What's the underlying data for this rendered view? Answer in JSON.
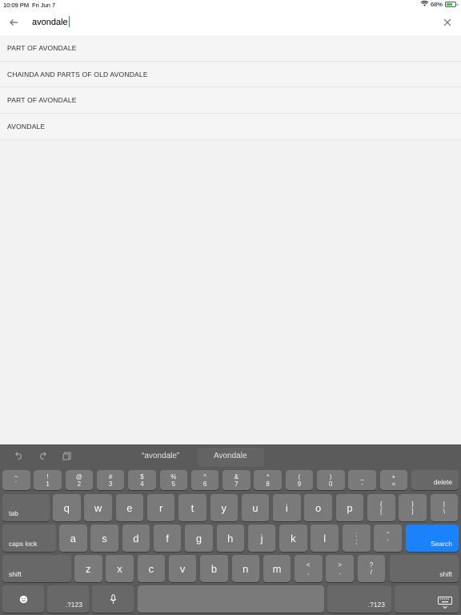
{
  "status_bar": {
    "time": "10:09 PM",
    "date": "Fri Jun 7",
    "battery_percent": "68%",
    "battery_level": 0.68,
    "wifi_icon": "wifi-icon"
  },
  "search": {
    "query": "avondale",
    "back_icon": "arrow-left-icon",
    "clear_icon": "close-icon"
  },
  "results": [
    {
      "label": "PART OF AVONDALE"
    },
    {
      "label": "CHAINDA AND PARTS OF OLD AVONDALE"
    },
    {
      "label": "PART OF AVONDALE"
    },
    {
      "label": "AVONDALE"
    }
  ],
  "keyboard": {
    "suggestions": [
      "“avondale”",
      "Avondale"
    ],
    "toolbar_icons": [
      "undo-icon",
      "redo-icon",
      "paste-icon"
    ],
    "number_row": [
      {
        "top": "~",
        "bot": "`"
      },
      {
        "top": "!",
        "bot": "1"
      },
      {
        "top": "@",
        "bot": "2"
      },
      {
        "top": "#",
        "bot": "3"
      },
      {
        "top": "$",
        "bot": "4"
      },
      {
        "top": "%",
        "bot": "5"
      },
      {
        "top": "^",
        "bot": "6"
      },
      {
        "top": "&",
        "bot": "7"
      },
      {
        "top": "*",
        "bot": "8"
      },
      {
        "top": "(",
        "bot": "9"
      },
      {
        "top": ")",
        "bot": "0"
      },
      {
        "top": "_",
        "bot": "-"
      },
      {
        "top": "+",
        "bot": "="
      }
    ],
    "delete_label": "delete",
    "tab_label": "tab",
    "row_q": [
      "q",
      "w",
      "e",
      "r",
      "t",
      "y",
      "u",
      "i",
      "o",
      "p"
    ],
    "row_q_sym": [
      {
        "top": "{",
        "bot": "["
      },
      {
        "top": "}",
        "bot": "]"
      },
      {
        "top": "|",
        "bot": "\\"
      }
    ],
    "caps_label": "caps lock",
    "row_a": [
      "a",
      "s",
      "d",
      "f",
      "g",
      "h",
      "j",
      "k",
      "l"
    ],
    "row_a_sym": [
      {
        "top": ":",
        "bot": ";"
      },
      {
        "top": "\"",
        "bot": "'"
      }
    ],
    "search_label": "Search",
    "shift_label": "shift",
    "row_z": [
      "z",
      "x",
      "c",
      "v",
      "b",
      "n",
      "m"
    ],
    "row_z_sym": [
      {
        "top": "<",
        "bot": ","
      },
      {
        "top": ">",
        "bot": "."
      },
      {
        "top": "?",
        "bot": "/"
      }
    ],
    "numbers_label": ".?123",
    "emoji_icon": "emoji-icon",
    "mic_icon": "microphone-icon",
    "dismiss_icon": "keyboard-dismiss-icon"
  }
}
